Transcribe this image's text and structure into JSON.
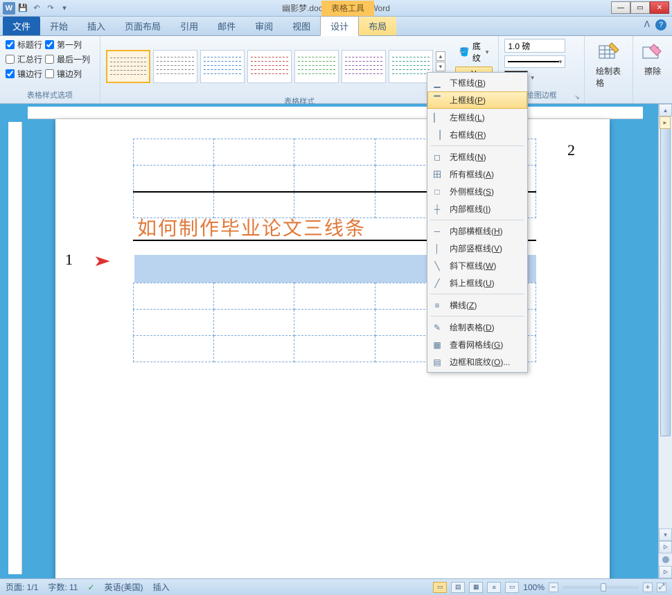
{
  "title": "幽影梦.docx - Microsoft Word",
  "contextual_tab": "表格工具",
  "tabs": {
    "file": "文件",
    "items": [
      "开始",
      "插入",
      "页面布局",
      "引用",
      "邮件",
      "审阅",
      "视图"
    ],
    "design": "设计",
    "layout": "布局"
  },
  "ribbon": {
    "style_options": {
      "label": "表格样式选项",
      "col1": [
        "标题行",
        "汇总行",
        "镶边行"
      ],
      "col2": [
        "第一列",
        "最后一列",
        "镶边列"
      ],
      "checked": {
        "标题行": true,
        "第一列": true,
        "汇总行": false,
        "最后一列": false,
        "镶边行": true,
        "镶边列": false
      }
    },
    "table_styles": {
      "label": "表格样式"
    },
    "shading": "底纹",
    "borders": "边框",
    "pen_weight": "1.0 磅",
    "draw_borders_label": "绘图边框",
    "draw_table": "绘制表格",
    "eraser": "擦除"
  },
  "border_menu": [
    {
      "label": "下框线",
      "hk": "B",
      "icon": "▁"
    },
    {
      "label": "上框线",
      "hk": "P",
      "icon": "▔",
      "hover": true
    },
    {
      "label": "左框线",
      "hk": "L",
      "icon": "▏"
    },
    {
      "label": "右框线",
      "hk": "R",
      "icon": "▕"
    },
    {
      "sep": true
    },
    {
      "label": "无框线",
      "hk": "N",
      "icon": "◻"
    },
    {
      "label": "所有框线",
      "hk": "A",
      "icon": "田"
    },
    {
      "label": "外侧框线",
      "hk": "S",
      "icon": "□"
    },
    {
      "label": "内部框线",
      "hk": "I",
      "icon": "┼"
    },
    {
      "sep": true
    },
    {
      "label": "内部横框线",
      "hk": "H",
      "icon": "─"
    },
    {
      "label": "内部竖框线",
      "hk": "V",
      "icon": "│"
    },
    {
      "label": "斜下框线",
      "hk": "W",
      "icon": "╲"
    },
    {
      "label": "斜上框线",
      "hk": "U",
      "icon": "╱"
    },
    {
      "sep": true
    },
    {
      "label": "横线",
      "hk": "Z",
      "icon": "≡"
    },
    {
      "sep": true
    },
    {
      "label": "绘制表格",
      "hk": "D",
      "icon": "✎"
    },
    {
      "label": "查看网格线",
      "hk": "G",
      "icon": "▦"
    },
    {
      "label": "边框和底纹",
      "hk": "O",
      "icon": "▤",
      "ellipsis": true
    }
  ],
  "document": {
    "heading": "如何制作毕业论文三线条",
    "annot1": "1",
    "annot2": "2"
  },
  "statusbar": {
    "page": "页面: 1/1",
    "words": "字数: 11",
    "lang": "英语(美国)",
    "mode": "插入",
    "zoom": "100%"
  }
}
